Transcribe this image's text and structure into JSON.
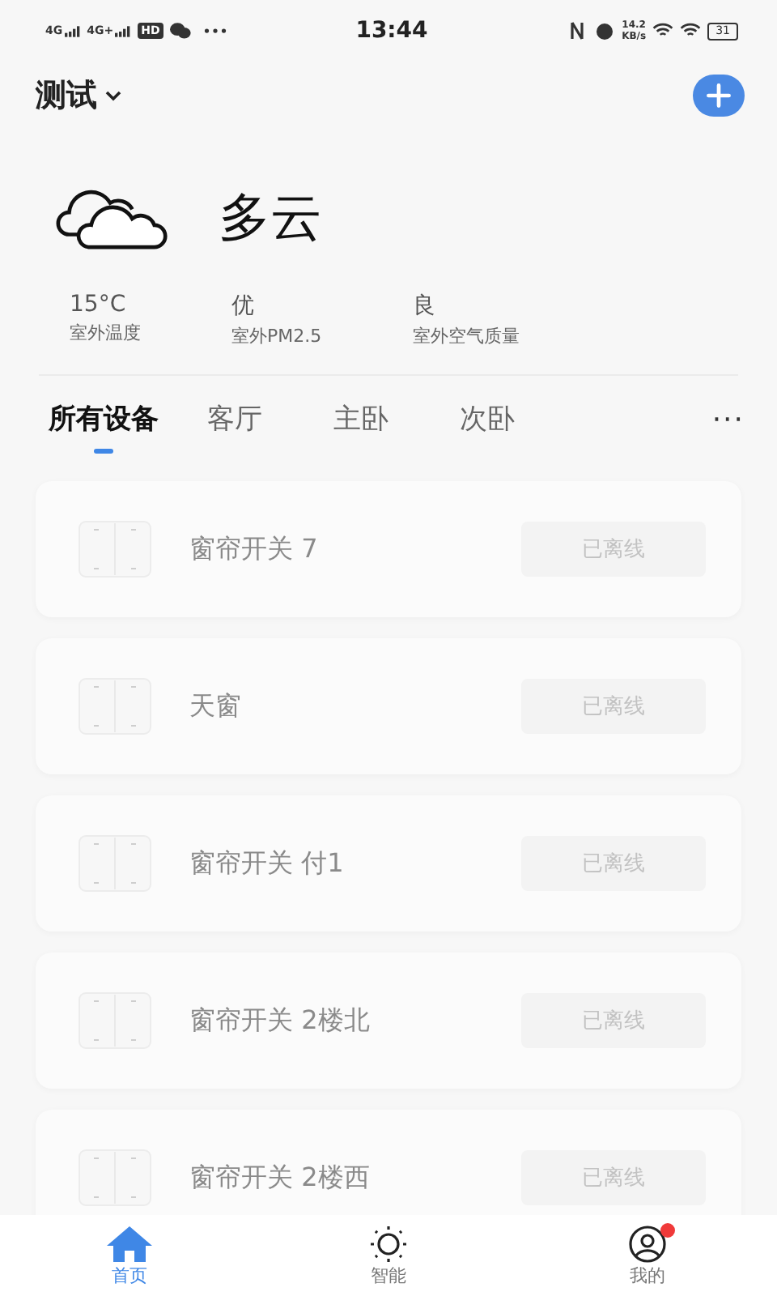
{
  "status_bar": {
    "networks": [
      "4G",
      "4G+"
    ],
    "hd": "HD",
    "time": "13:44",
    "speed": "14.2",
    "speed_unit": "KB/s",
    "battery": "31"
  },
  "header": {
    "home": "测试"
  },
  "weather": {
    "condition": "多云",
    "stats": [
      {
        "value": "15°C",
        "label": "室外温度"
      },
      {
        "value": "优",
        "label": "室外PM2.5"
      },
      {
        "value": "良",
        "label": "室外空气质量"
      }
    ]
  },
  "tabs": [
    {
      "label": "所有设备",
      "selected": true
    },
    {
      "label": "客厅",
      "selected": false
    },
    {
      "label": "主卧",
      "selected": false
    },
    {
      "label": "次卧",
      "selected": false
    }
  ],
  "more": "···",
  "devices": [
    {
      "name": "窗帘开关 7",
      "status": "已离线",
      "offline": true
    },
    {
      "name": "天窗",
      "status": "已离线",
      "offline": true
    },
    {
      "name": "窗帘开关 付1",
      "status": "已离线",
      "offline": true
    },
    {
      "name": "窗帘开关 2楼北",
      "status": "已离线",
      "offline": true
    },
    {
      "name": "窗帘开关 2楼西",
      "status": "已离线",
      "offline": true
    }
  ],
  "bottom_nav": [
    {
      "kind": "home",
      "label": "首页",
      "selected": true,
      "badge": false
    },
    {
      "kind": "smart",
      "label": "智能",
      "selected": false,
      "badge": false
    },
    {
      "kind": "profile",
      "label": "我的",
      "selected": false,
      "badge": true
    }
  ]
}
